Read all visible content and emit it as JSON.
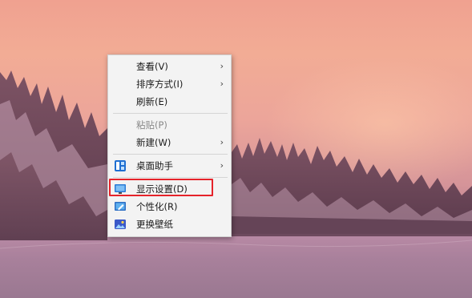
{
  "context_menu": {
    "items": [
      {
        "label": "查看(V)",
        "submenu": true
      },
      {
        "label": "排序方式(I)",
        "submenu": true
      },
      {
        "label": "刷新(E)"
      },
      {
        "label": "粘贴(P)",
        "disabled": true
      },
      {
        "label": "新建(W)",
        "submenu": true
      },
      {
        "label": "桌面助手",
        "icon": "desktop-assistant-icon",
        "submenu": true
      },
      {
        "label": "显示设置(D)",
        "icon": "display-settings-icon",
        "highlighted": true
      },
      {
        "label": "个性化(R)",
        "icon": "personalize-icon"
      },
      {
        "label": "更换壁纸",
        "icon": "wallpaper-icon"
      }
    ],
    "chevron": "›"
  },
  "colors": {
    "highlight_border": "#e5232a",
    "menu_background": "#f3f3f3"
  }
}
